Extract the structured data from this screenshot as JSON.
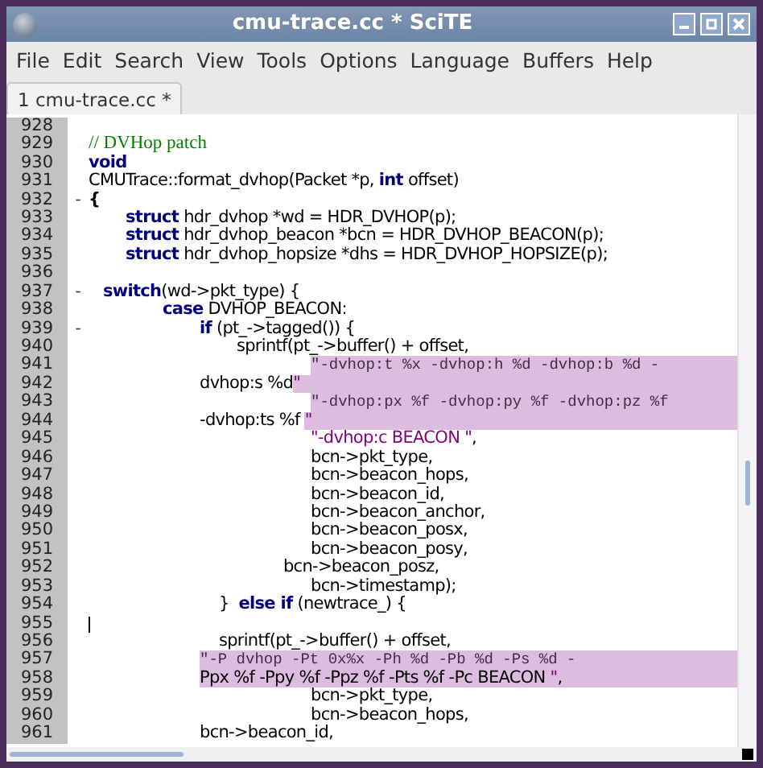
{
  "window": {
    "title": "cmu-trace.cc * SciTE"
  },
  "menu": [
    "File",
    "Edit",
    "Search",
    "View",
    "Tools",
    "Options",
    "Language",
    "Buffers",
    "Help"
  ],
  "tabs": [
    {
      "label": "1 cmu-trace.cc *",
      "selected": true
    }
  ],
  "editor": {
    "lines": [
      {
        "number": "928",
        "caret": false
      },
      {
        "number": "929",
        "caret": false,
        "segments": [
          {
            "kind": "comment",
            "text": "// DVHop patch",
            "highlighted": false
          }
        ]
      },
      {
        "number": "930",
        "caret": false,
        "segments": [
          {
            "kind": "keyword",
            "text": "void",
            "highlighted": false
          }
        ]
      },
      {
        "number": "931",
        "caret": false,
        "segments": [
          {
            "kind": "plain",
            "text": "CMUTrace::format_dvhop(Packet *p, ",
            "highlighted": false
          },
          {
            "kind": "keyword",
            "text": "int",
            "highlighted": false
          },
          {
            "kind": "plain",
            "text": " offset)",
            "highlighted": false
          }
        ]
      },
      {
        "number": "932",
        "fold": "-",
        "caret": false,
        "segments": [
          {
            "kind": "operator",
            "text": "{",
            "highlighted": false
          }
        ]
      },
      {
        "number": "933",
        "caret": false,
        "segments": [
          {
            "kind": "keyword",
            "text": "\tstruct",
            "highlighted": false
          },
          {
            "kind": "plain",
            "text": " hdr_dvhop *wd = HDR_DVHOP(p);",
            "highlighted": false
          }
        ]
      },
      {
        "number": "934",
        "caret": false,
        "segments": [
          {
            "kind": "keyword",
            "text": "\tstruct",
            "highlighted": false
          },
          {
            "kind": "plain",
            "text": " hdr_dvhop_beacon *bcn = HDR_DVHOP_BEACON(p);",
            "highlighted": false
          }
        ]
      },
      {
        "number": "935",
        "caret": false,
        "segments": [
          {
            "kind": "keyword",
            "text": "\tstruct",
            "highlighted": false
          },
          {
            "kind": "plain",
            "text": " hdr_dvhop_hopsize *dhs = HDR_DVHOP_HOPSIZE(p);",
            "highlighted": false
          }
        ]
      },
      {
        "number": "936",
        "caret": false
      },
      {
        "number": "937",
        "fold": "-",
        "caret": false,
        "segments": [
          {
            "kind": "keyword",
            "text": "   switch",
            "highlighted": false
          },
          {
            "kind": "plain",
            "text": "(wd->pkt_type) {",
            "highlighted": false
          }
        ]
      },
      {
        "number": "938",
        "caret": false,
        "segments": [
          {
            "kind": "keyword",
            "text": "\t\tcase",
            "highlighted": false
          },
          {
            "kind": "plain",
            "text": " DVHOP_BEACON:",
            "highlighted": false
          }
        ]
      },
      {
        "number": "939",
        "fold": "-",
        "caret": false,
        "segments": [
          {
            "kind": "keyword",
            "text": "\t\t\tif",
            "highlighted": false
          },
          {
            "kind": "plain",
            "text": " (pt_->tagged()) {",
            "highlighted": false
          }
        ]
      },
      {
        "number": "940",
        "caret": false,
        "segments": [
          {
            "kind": "plain",
            "text": "\t\t\t\tsprintf(pt_->buffer() + offset,",
            "highlighted": false
          }
        ]
      },
      {
        "number": "941",
        "caret": false,
        "segments": [
          {
            "kind": "string_mono",
            "text": "\t\t\t\t\t\t\"-dvhop:t %x -dvhop:h %d -dvhop:b %d -",
            "highlighted": true
          }
        ]
      },
      {
        "number": "942",
        "caret": false,
        "segments": [
          {
            "kind": "plain",
            "text": "\t\t\tdvhop:s %d",
            "highlighted": false
          },
          {
            "kind": "string",
            "text": "\"",
            "highlighted": true
          }
        ]
      },
      {
        "number": "943",
        "caret": false,
        "segments": [
          {
            "kind": "string_mono",
            "text": "\t\t\t\t\t\t\"-dvhop:px %f -dvhop:py %f -dvhop:pz %f",
            "highlighted": true
          }
        ]
      },
      {
        "number": "944",
        "caret": false,
        "segments": [
          {
            "kind": "plain",
            "text": "\t\t\t-dvhop:ts %f ",
            "highlighted": false
          },
          {
            "kind": "string",
            "text": "\"",
            "highlighted": true
          }
        ]
      },
      {
        "number": "945",
        "caret": false,
        "segments": [
          {
            "kind": "string",
            "text": "\t\t\t\t\t\t\"-dvhop:c BEACON \"",
            "highlighted": false
          },
          {
            "kind": "plain",
            "text": ",",
            "highlighted": false
          }
        ]
      },
      {
        "number": "946",
        "caret": false,
        "segments": [
          {
            "kind": "plain",
            "text": "\t\t\t\t\t\tbcn->pkt_type,",
            "highlighted": false
          }
        ]
      },
      {
        "number": "947",
        "caret": false,
        "segments": [
          {
            "kind": "plain",
            "text": "\t\t\t\t\t\tbcn->beacon_hops,",
            "highlighted": false
          }
        ]
      },
      {
        "number": "948",
        "caret": false,
        "segments": [
          {
            "kind": "plain",
            "text": "\t\t\t\t\t\tbcn->beacon_id,",
            "highlighted": false
          }
        ]
      },
      {
        "number": "949",
        "caret": false,
        "segments": [
          {
            "kind": "plain",
            "text": "\t\t\t\t\t\tbcn->beacon_anchor,",
            "highlighted": false
          }
        ]
      },
      {
        "number": "950",
        "caret": false,
        "segments": [
          {
            "kind": "plain",
            "text": "\t\t\t\t\t\tbcn->beacon_posx,",
            "highlighted": false
          }
        ]
      },
      {
        "number": "951",
        "caret": false,
        "segments": [
          {
            "kind": "plain",
            "text": "\t\t\t\t\t\tbcn->beacon_posy,",
            "highlighted": false
          }
        ]
      },
      {
        "number": "952",
        "caret": false,
        "segments": [
          {
            "kind": "plain",
            "text": "\t\t\t\t\t  bcn->beacon_posz,",
            "highlighted": false
          }
        ]
      },
      {
        "number": "953",
        "caret": false,
        "segments": [
          {
            "kind": "plain",
            "text": "\t\t\t\t\t\tbcn->timestamp);",
            "highlighted": false
          }
        ]
      },
      {
        "number": "954",
        "caret": false,
        "segments": [
          {
            "kind": "plain",
            "text": "\t\t\t    }  ",
            "highlighted": false
          },
          {
            "kind": "keyword",
            "text": "else if",
            "highlighted": false
          },
          {
            "kind": "plain",
            "text": " (newtrace_) {",
            "highlighted": false
          }
        ]
      },
      {
        "number": "955",
        "caret": true
      },
      {
        "number": "956",
        "caret": false,
        "segments": [
          {
            "kind": "plain",
            "text": "\t\t\t    sprintf(pt_->buffer() + offset,",
            "highlighted": false
          }
        ]
      },
      {
        "number": "957",
        "caret": false,
        "segments": [
          {
            "kind": "string_mono",
            "text": "\t\t\t\"-P dvhop -Pt 0x%x -Ph %d -Pb %d -Ps %d -",
            "highlighted": true
          }
        ]
      },
      {
        "number": "958",
        "caret": false,
        "segments": [
          {
            "kind": "plain",
            "text": "\t\t\tPpx %f -Ppy %f -Ppz %f -Pts %f -Pc BEACON ",
            "highlighted": true
          },
          {
            "kind": "string",
            "text": "\"",
            "highlighted": true
          },
          {
            "kind": "plain",
            "text": ",",
            "highlighted": true
          }
        ]
      },
      {
        "number": "959",
        "caret": false,
        "segments": [
          {
            "kind": "plain",
            "text": "\t\t\t\t\t\tbcn->pkt_type,",
            "highlighted": false
          }
        ]
      },
      {
        "number": "960",
        "caret": false,
        "segments": [
          {
            "kind": "plain",
            "text": "\t\t\t\t\t\tbcn->beacon_hops,",
            "highlighted": false
          }
        ]
      },
      {
        "number": "961",
        "caret": false,
        "segments": [
          {
            "kind": "plain",
            "text": "\t\t\tbcn->beacon_id,",
            "highlighted": false
          }
        ]
      }
    ]
  }
}
